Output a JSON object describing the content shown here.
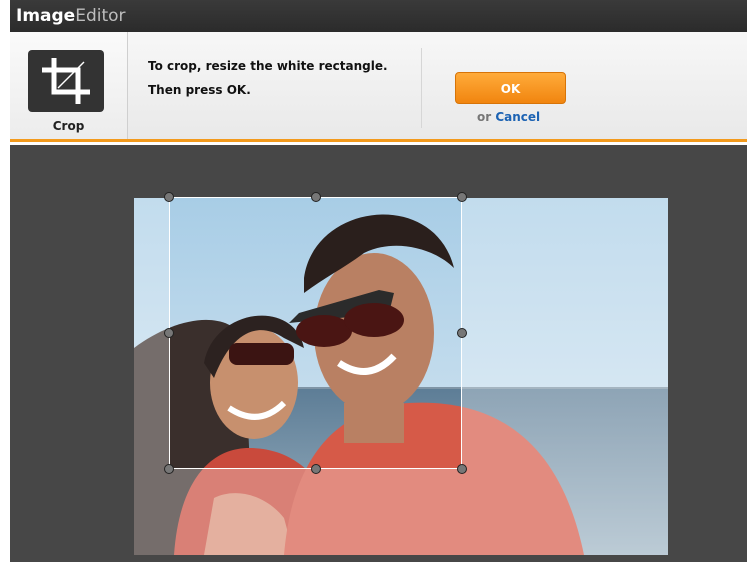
{
  "app": {
    "title_bold": "Image",
    "title_light": "Editor"
  },
  "tool": {
    "label": "Crop",
    "icon": "crop-icon"
  },
  "instructions": {
    "line1": "To crop, resize the white rectangle.",
    "line2": "Then press OK."
  },
  "actions": {
    "ok_label": "OK",
    "or_text": "or",
    "cancel_label": "Cancel"
  },
  "colors": {
    "accent": "#f39a1c",
    "ok_button": "#f59a22",
    "cancel_link": "#1d63b3",
    "workspace_bg": "#474747"
  }
}
